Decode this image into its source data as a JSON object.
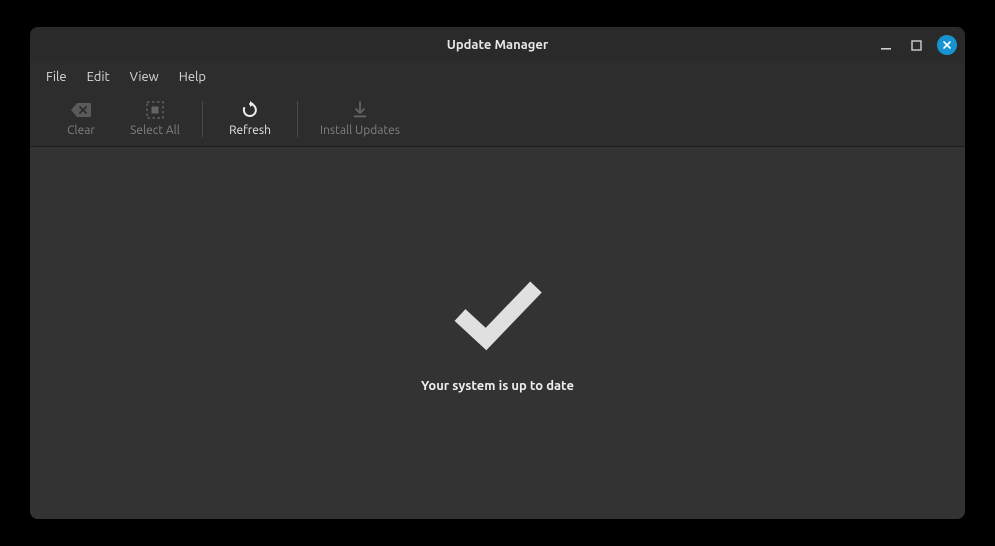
{
  "window": {
    "title": "Update Manager"
  },
  "menubar": {
    "file": "File",
    "edit": "Edit",
    "view": "View",
    "help": "Help"
  },
  "toolbar": {
    "clear": {
      "label": "Clear",
      "icon": "clear-icon",
      "disabled": true
    },
    "select_all": {
      "label": "Select All",
      "icon": "select-all-icon",
      "disabled": true
    },
    "refresh": {
      "label": "Refresh",
      "icon": "refresh-icon",
      "disabled": false
    },
    "install_updates": {
      "label": "Install Updates",
      "icon": "install-icon",
      "disabled": true
    }
  },
  "content": {
    "status_icon": "checkmark-icon",
    "status_message": "Your system is up to date"
  },
  "colors": {
    "window_bg": "#2d2d2d",
    "content_bg": "#333333",
    "accent": "#1793d1",
    "text": "#e6e6e6"
  }
}
